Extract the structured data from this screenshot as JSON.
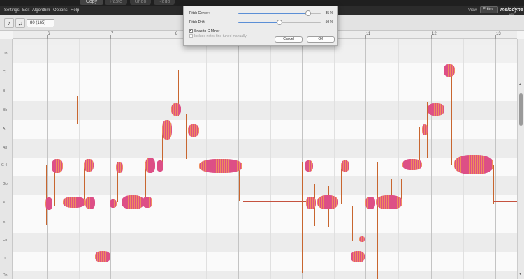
{
  "toolbar_top": {
    "buttons": [
      {
        "label": "Copy",
        "active": true
      },
      {
        "label": "Paste",
        "active": false
      },
      {
        "label": "Undo",
        "active": false
      },
      {
        "label": "Redo",
        "active": false
      }
    ]
  },
  "menubar": {
    "items": [
      "Settings",
      "Edit",
      "Algorithm",
      "Options",
      "Help"
    ],
    "view_label": "View",
    "view_value": "Editor",
    "brand": "melodyne",
    "brand_sub": "editor"
  },
  "toolbar": {
    "tempo_value": "80 (165)"
  },
  "ruler": {
    "bars": [
      "6",
      "7",
      "8",
      "9",
      "10",
      "11",
      "12",
      "13"
    ]
  },
  "pitch_axis": {
    "labels": [
      "Db",
      "C",
      "B",
      "Bb",
      "A",
      "Ab",
      "G 4",
      "Gb",
      "F",
      "E",
      "Eb",
      "D",
      "Db"
    ]
  },
  "dialog": {
    "pitch_center_label": "Pitch Center:",
    "pitch_center_value": "85 %",
    "pitch_center_level": 85,
    "pitch_drift_label": "Pitch Drift:",
    "pitch_drift_value": "50 %",
    "pitch_drift_level": 50,
    "snap_label": "Snap to G Minor",
    "snap_checked": true,
    "include_label": "Include notes fine-tuned manually",
    "include_checked": false,
    "cancel_label": "Cancel",
    "ok_label": "OK"
  },
  "colors": {
    "blob": "#dd4f86",
    "blob_highlight": "#ffbe3c",
    "pitch_line": "#c8662f",
    "accent": "#5b8fd6"
  }
}
